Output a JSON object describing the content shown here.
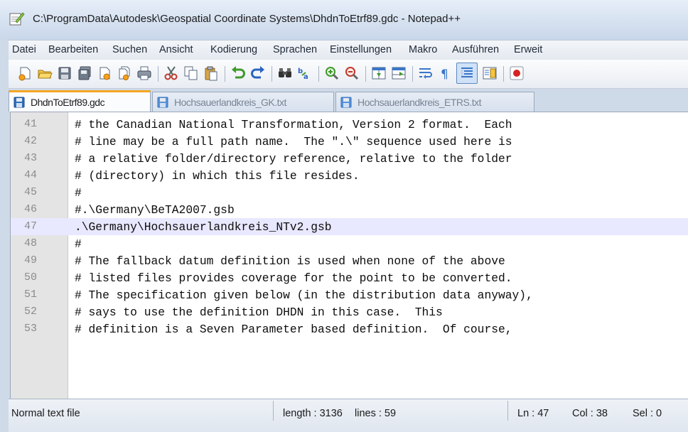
{
  "window": {
    "title": "C:\\ProgramData\\Autodesk\\Geospatial Coordinate Systems\\DhdnToEtrf89.gdc - Notepad++"
  },
  "menu": [
    "Datei",
    "Bearbeiten",
    "Suchen",
    "Ansicht",
    "Kodierung",
    "Sprachen",
    "Einstellungen",
    "Makro",
    "Ausführen",
    "Erweit"
  ],
  "toolbar": {
    "buttons": [
      "new-file-icon",
      "open-file-icon",
      "save-icon",
      "save-all-icon",
      "close-icon",
      "close-all-icon",
      "print-icon",
      "cut-icon",
      "copy-icon",
      "paste-icon",
      "undo-icon",
      "redo-icon",
      "find-icon",
      "replace-icon",
      "zoom-in-icon",
      "zoom-out-icon",
      "sync-vertical-icon",
      "sync-horizontal-icon",
      "word-wrap-icon",
      "show-all-chars-icon",
      "indent-guide-icon",
      "doc-map-icon",
      "record-macro-icon"
    ],
    "active_button": "indent-guide-icon"
  },
  "tabs": [
    {
      "label": "DhdnToEtrf89.gdc",
      "active": true
    },
    {
      "label": "Hochsauerlandkreis_GK.txt",
      "active": false
    },
    {
      "label": "Hochsauerlandkreis_ETRS.txt",
      "active": false
    }
  ],
  "editor": {
    "current_line": "47",
    "lines": [
      {
        "n": "41",
        "text": "# the Canadian National Transformation, Version 2 format.  Each"
      },
      {
        "n": "42",
        "text": "# line may be a full path name.  The \".\\\" sequence used here is"
      },
      {
        "n": "43",
        "text": "# a relative folder/directory reference, relative to the folder"
      },
      {
        "n": "44",
        "text": "# (directory) in which this file resides."
      },
      {
        "n": "45",
        "text": "#"
      },
      {
        "n": "46",
        "text": "#.\\Germany\\BeTA2007.gsb"
      },
      {
        "n": "47",
        "text": ".\\Germany\\Hochsauerlandkreis_NTv2.gsb"
      },
      {
        "n": "48",
        "text": "#"
      },
      {
        "n": "49",
        "text": "# The fallback datum definition is used when none of the above"
      },
      {
        "n": "50",
        "text": "# listed files provides coverage for the point to be converted."
      },
      {
        "n": "51",
        "text": "# The specification given below (in the distribution data anyway),"
      },
      {
        "n": "52",
        "text": "# says to use the definition DHDN in this case.  This"
      },
      {
        "n": "53",
        "text": "# definition is a Seven Parameter based definition.  Of course,"
      }
    ]
  },
  "status": {
    "file_type": "Normal text file",
    "length": "length : 3136",
    "lines": "lines : 59",
    "ln": "Ln : 47",
    "col": "Col : 38",
    "sel": "Sel : 0"
  },
  "colors": {
    "active_tab_accent": "#f5a623",
    "current_line_bg": "#e8e8ff"
  }
}
